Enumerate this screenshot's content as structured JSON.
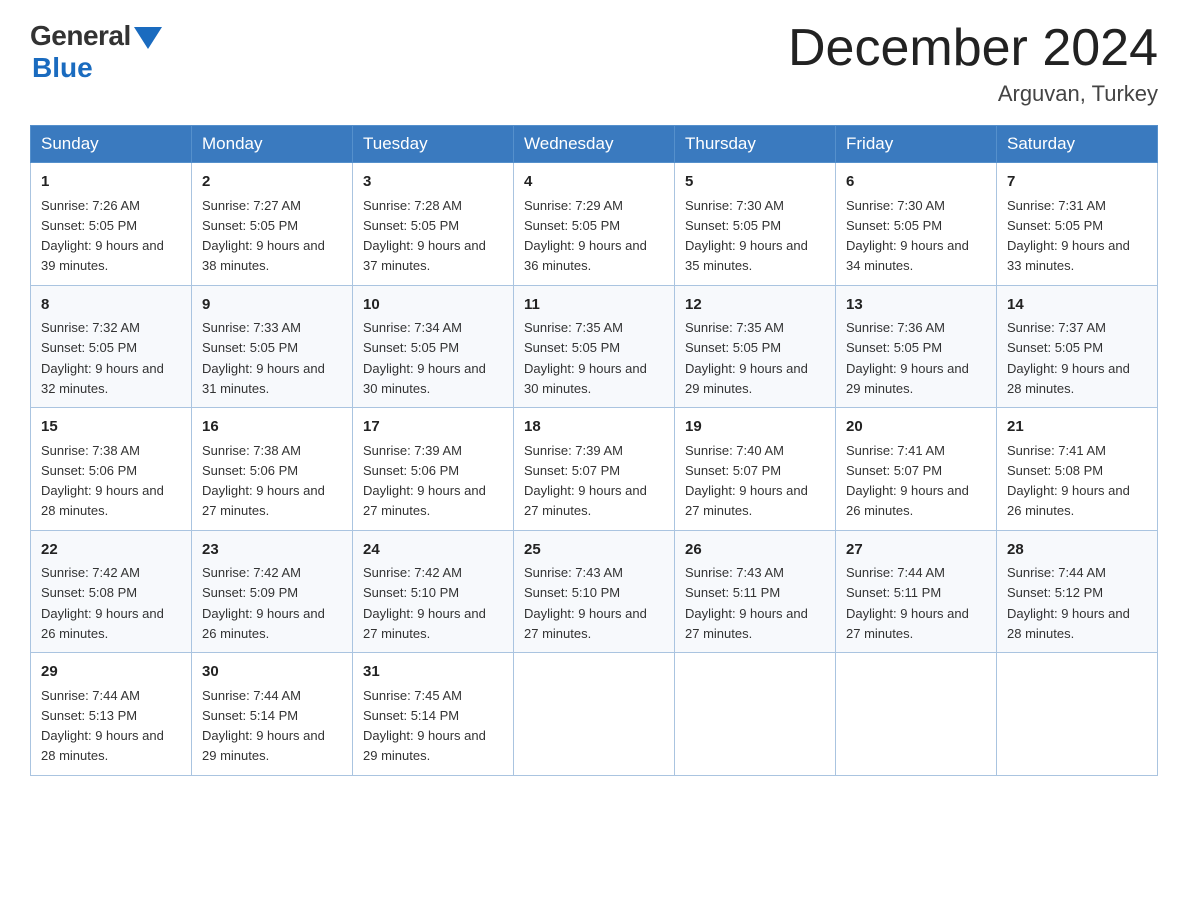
{
  "header": {
    "logo_general": "General",
    "logo_blue": "Blue",
    "title": "December 2024",
    "location": "Arguvan, Turkey"
  },
  "days_of_week": [
    "Sunday",
    "Monday",
    "Tuesday",
    "Wednesday",
    "Thursday",
    "Friday",
    "Saturday"
  ],
  "weeks": [
    [
      {
        "day": "1",
        "sunrise": "7:26 AM",
        "sunset": "5:05 PM",
        "daylight": "9 hours and 39 minutes."
      },
      {
        "day": "2",
        "sunrise": "7:27 AM",
        "sunset": "5:05 PM",
        "daylight": "9 hours and 38 minutes."
      },
      {
        "day": "3",
        "sunrise": "7:28 AM",
        "sunset": "5:05 PM",
        "daylight": "9 hours and 37 minutes."
      },
      {
        "day": "4",
        "sunrise": "7:29 AM",
        "sunset": "5:05 PM",
        "daylight": "9 hours and 36 minutes."
      },
      {
        "day": "5",
        "sunrise": "7:30 AM",
        "sunset": "5:05 PM",
        "daylight": "9 hours and 35 minutes."
      },
      {
        "day": "6",
        "sunrise": "7:30 AM",
        "sunset": "5:05 PM",
        "daylight": "9 hours and 34 minutes."
      },
      {
        "day": "7",
        "sunrise": "7:31 AM",
        "sunset": "5:05 PM",
        "daylight": "9 hours and 33 minutes."
      }
    ],
    [
      {
        "day": "8",
        "sunrise": "7:32 AM",
        "sunset": "5:05 PM",
        "daylight": "9 hours and 32 minutes."
      },
      {
        "day": "9",
        "sunrise": "7:33 AM",
        "sunset": "5:05 PM",
        "daylight": "9 hours and 31 minutes."
      },
      {
        "day": "10",
        "sunrise": "7:34 AM",
        "sunset": "5:05 PM",
        "daylight": "9 hours and 30 minutes."
      },
      {
        "day": "11",
        "sunrise": "7:35 AM",
        "sunset": "5:05 PM",
        "daylight": "9 hours and 30 minutes."
      },
      {
        "day": "12",
        "sunrise": "7:35 AM",
        "sunset": "5:05 PM",
        "daylight": "9 hours and 29 minutes."
      },
      {
        "day": "13",
        "sunrise": "7:36 AM",
        "sunset": "5:05 PM",
        "daylight": "9 hours and 29 minutes."
      },
      {
        "day": "14",
        "sunrise": "7:37 AM",
        "sunset": "5:05 PM",
        "daylight": "9 hours and 28 minutes."
      }
    ],
    [
      {
        "day": "15",
        "sunrise": "7:38 AM",
        "sunset": "5:06 PM",
        "daylight": "9 hours and 28 minutes."
      },
      {
        "day": "16",
        "sunrise": "7:38 AM",
        "sunset": "5:06 PM",
        "daylight": "9 hours and 27 minutes."
      },
      {
        "day": "17",
        "sunrise": "7:39 AM",
        "sunset": "5:06 PM",
        "daylight": "9 hours and 27 minutes."
      },
      {
        "day": "18",
        "sunrise": "7:39 AM",
        "sunset": "5:07 PM",
        "daylight": "9 hours and 27 minutes."
      },
      {
        "day": "19",
        "sunrise": "7:40 AM",
        "sunset": "5:07 PM",
        "daylight": "9 hours and 27 minutes."
      },
      {
        "day": "20",
        "sunrise": "7:41 AM",
        "sunset": "5:07 PM",
        "daylight": "9 hours and 26 minutes."
      },
      {
        "day": "21",
        "sunrise": "7:41 AM",
        "sunset": "5:08 PM",
        "daylight": "9 hours and 26 minutes."
      }
    ],
    [
      {
        "day": "22",
        "sunrise": "7:42 AM",
        "sunset": "5:08 PM",
        "daylight": "9 hours and 26 minutes."
      },
      {
        "day": "23",
        "sunrise": "7:42 AM",
        "sunset": "5:09 PM",
        "daylight": "9 hours and 26 minutes."
      },
      {
        "day": "24",
        "sunrise": "7:42 AM",
        "sunset": "5:10 PM",
        "daylight": "9 hours and 27 minutes."
      },
      {
        "day": "25",
        "sunrise": "7:43 AM",
        "sunset": "5:10 PM",
        "daylight": "9 hours and 27 minutes."
      },
      {
        "day": "26",
        "sunrise": "7:43 AM",
        "sunset": "5:11 PM",
        "daylight": "9 hours and 27 minutes."
      },
      {
        "day": "27",
        "sunrise": "7:44 AM",
        "sunset": "5:11 PM",
        "daylight": "9 hours and 27 minutes."
      },
      {
        "day": "28",
        "sunrise": "7:44 AM",
        "sunset": "5:12 PM",
        "daylight": "9 hours and 28 minutes."
      }
    ],
    [
      {
        "day": "29",
        "sunrise": "7:44 AM",
        "sunset": "5:13 PM",
        "daylight": "9 hours and 28 minutes."
      },
      {
        "day": "30",
        "sunrise": "7:44 AM",
        "sunset": "5:14 PM",
        "daylight": "9 hours and 29 minutes."
      },
      {
        "day": "31",
        "sunrise": "7:45 AM",
        "sunset": "5:14 PM",
        "daylight": "9 hours and 29 minutes."
      },
      null,
      null,
      null,
      null
    ]
  ]
}
